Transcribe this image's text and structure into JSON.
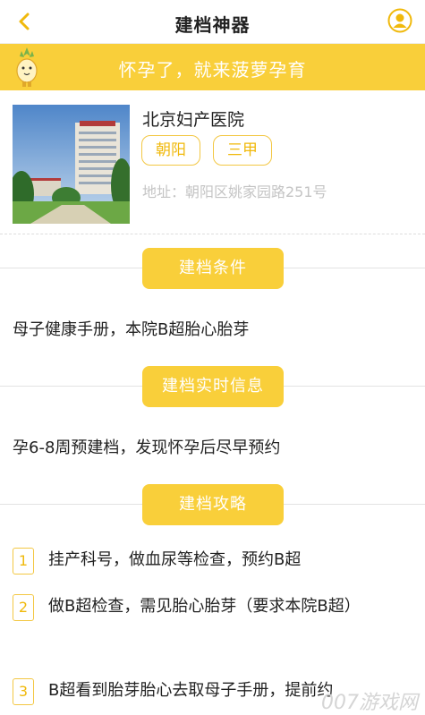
{
  "header": {
    "title": "建档神器",
    "back_icon": "chevron-left-icon",
    "user_icon": "user-icon",
    "accent": "#f9cf3a"
  },
  "banner": {
    "text": "怀孕了，就来菠萝孕育"
  },
  "hospital": {
    "name": "北京妇产医院",
    "tags": [
      "朝阳",
      "三甲"
    ],
    "address": "地址：朝阳区姚家园路251号"
  },
  "sections": {
    "conditions": {
      "title": "建档条件",
      "text": "母子健康手册，本院B超胎心胎芽"
    },
    "realtime": {
      "title": "建档实时信息",
      "text": "孕6-8周预建档，发现怀孕后尽早预约"
    },
    "guide": {
      "title": "建档攻略"
    }
  },
  "steps": [
    {
      "num": "1",
      "text": "挂产科号，做血尿等检查，预约B超"
    },
    {
      "num": "2",
      "text": "做B超检查，需见胎心胎芽（要求本院B超）"
    },
    {
      "num": "3",
      "text": "B超看到胎芽胎心去取母子手册，提前约"
    }
  ],
  "watermark": "007游戏网"
}
